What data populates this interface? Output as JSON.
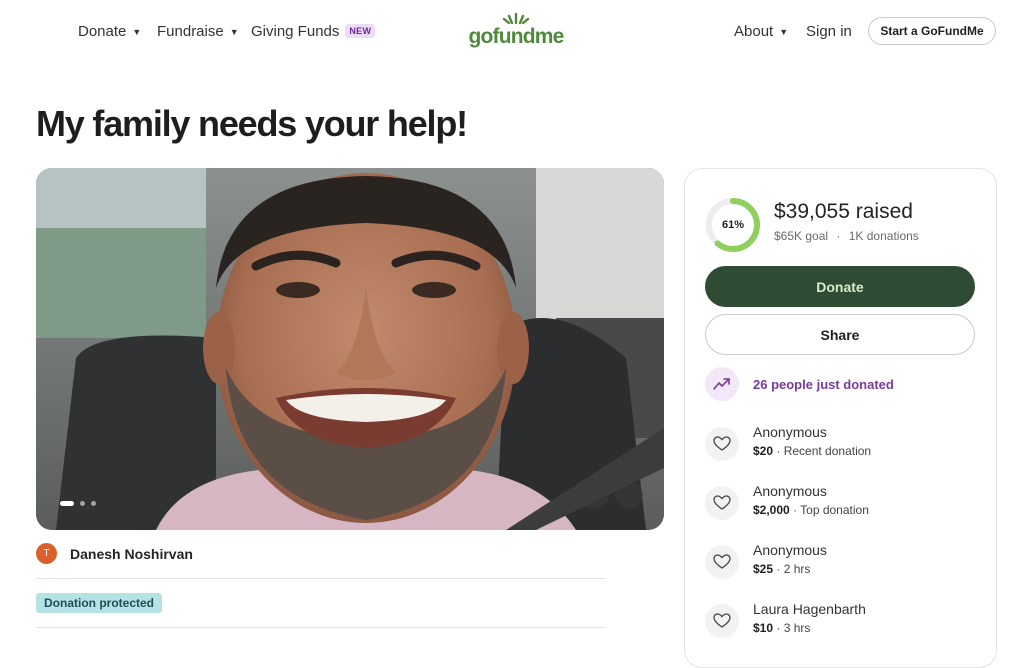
{
  "header": {
    "nav_left": [
      {
        "label": "Donate",
        "caret": true
      },
      {
        "label": "Fundraise",
        "caret": true
      },
      {
        "label": "Giving Funds",
        "badge": "NEW"
      }
    ],
    "logo": "gofundme",
    "nav_right": [
      {
        "label": "About",
        "caret": true
      },
      {
        "label": "Sign in"
      }
    ],
    "start_button": "Start a GoFundMe"
  },
  "title": "My family needs your help!",
  "photo": {
    "icon": "photo-of-man-in-car",
    "slides_total": 3,
    "slide_active": 1
  },
  "organizer": {
    "avatar_initial": "T",
    "avatar_color": "#d95f2b",
    "name": "Danesh Noshirvan"
  },
  "protection_badge": "Donation protected",
  "card": {
    "percent_label": "61%",
    "percent_value": 0.61,
    "raised_text": "$39,055 raised",
    "goal_text": "$65K goal",
    "donations_text": "1K donations",
    "separator": "·",
    "donate_label": "Donate",
    "share_label": "Share",
    "trending_text": "26 people just donated",
    "donations": [
      {
        "name": "Anonymous",
        "amount": "$20",
        "note": " · Recent donation"
      },
      {
        "name": "Anonymous",
        "amount": "$2,000",
        "note": " · Top donation"
      },
      {
        "name": "Anonymous",
        "amount": "$25",
        "note": " · 2 hrs"
      },
      {
        "name": "Laura Hagenbarth",
        "amount": "$10",
        "note": " · 3 hrs"
      }
    ]
  },
  "colors": {
    "brand_green": "#4e8a3a",
    "donate_button": "#2f4b33",
    "ring_progress": "#8fcf5d",
    "trending_purple": "#7a3a9a"
  }
}
